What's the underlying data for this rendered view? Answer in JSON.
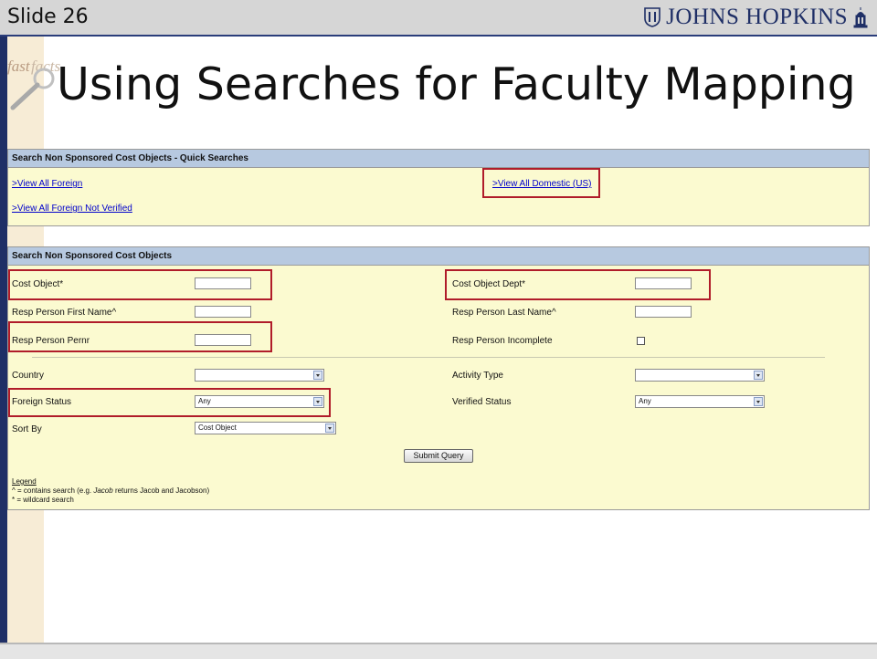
{
  "slide": {
    "label": "Slide 26",
    "title": "Using Searches for Faculty Mapping"
  },
  "logo": {
    "text": "JOHNS HOPKINS",
    "mark_text": "fast facts"
  },
  "quick_searches": {
    "header": "Search Non Sponsored Cost Objects - Quick Searches",
    "links": [
      ">View All Foreign",
      ">View All Domestic (US)",
      ">View All Foreign Not Verified"
    ]
  },
  "search": {
    "header": "Search Non Sponsored Cost Objects",
    "fields": {
      "cost_object": "Cost Object*",
      "cost_object_dept": "Cost Object Dept*",
      "resp_first": "Resp Person First Name^",
      "resp_last": "Resp Person Last Name^",
      "resp_pernr": "Resp Person Pernr",
      "resp_incomplete": "Resp Person Incomplete",
      "country": "Country",
      "activity_type": "Activity Type",
      "foreign_status": "Foreign Status",
      "verified_status": "Verified Status",
      "sort_by": "Sort By"
    },
    "selected": {
      "country": "",
      "activity_type": "",
      "foreign_status": "Any",
      "verified_status": "Any",
      "sort_by": "Cost Object"
    },
    "submit_label": "Submit Query",
    "legend": {
      "title": "Legend",
      "line1_prefix": "^ = contains search (e.g. ",
      "line1_em": "Jacob",
      "line1_suffix": " returns Jacob and Jacobson)",
      "line2": "* = wildcard search"
    }
  },
  "colors": {
    "highlight": "#b01c2a",
    "panel_bg": "#fbfad0",
    "header_bg": "#b7c9e0",
    "link": "#0000cc"
  }
}
